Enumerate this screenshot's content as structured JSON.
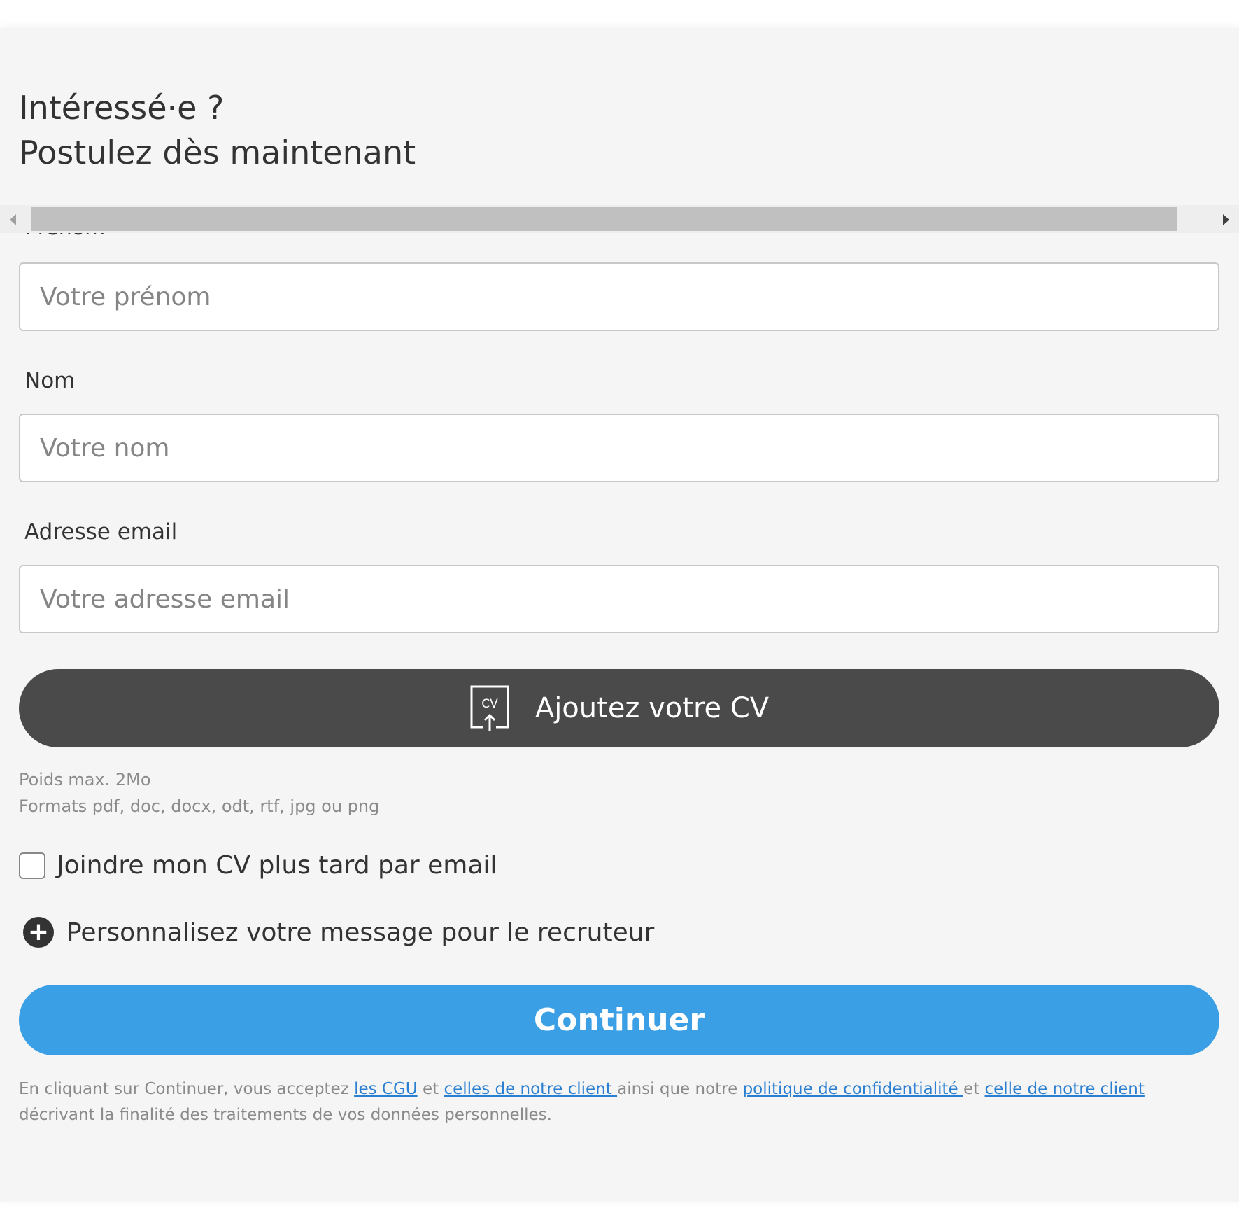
{
  "header": {
    "line1": "Intéressé·e ?",
    "line2": "Postulez dès maintenant"
  },
  "form": {
    "first_name_label": "Prénom",
    "first_name_placeholder": "Votre prénom",
    "last_name_label": "Nom",
    "last_name_placeholder": "Votre nom",
    "email_label": "Adresse email",
    "email_placeholder": "Votre adresse email",
    "cv_button_label": "Ajoutez votre CV",
    "cv_icon_text": "CV",
    "hint_max_size": "Poids max. 2Mo",
    "hint_formats": "Formats pdf, doc, docx, odt, rtf, jpg ou png",
    "later_checkbox_label": "Joindre mon CV plus tard par email",
    "later_checkbox_checked": false,
    "personalize_label": "Personnalisez votre message pour le recruteur",
    "continue_label": "Continuer"
  },
  "legal": {
    "text_1": "En cliquant sur Continuer, vous acceptez ",
    "link_cgu": "les CGU",
    "text_2": " et ",
    "link_client_terms": "celles de notre client ",
    "text_3": "ainsi que notre ",
    "link_privacy": "politique de confidentialité ",
    "text_4": "et ",
    "link_client_privacy": "celle de notre client",
    "text_5": " décrivant la finalité des traitements de vos données personnelles."
  },
  "colors": {
    "panel_background": "#f5f5f5",
    "cv_button": "#4a4a4a",
    "continue_button": "#3a9fe5",
    "link": "#2b7fd1"
  },
  "icons": {
    "cv_upload": "cv-upload-icon",
    "plus": "plus-circle-icon",
    "scroll_left": "scroll-left-arrow-icon",
    "scroll_right": "scroll-right-arrow-icon"
  }
}
